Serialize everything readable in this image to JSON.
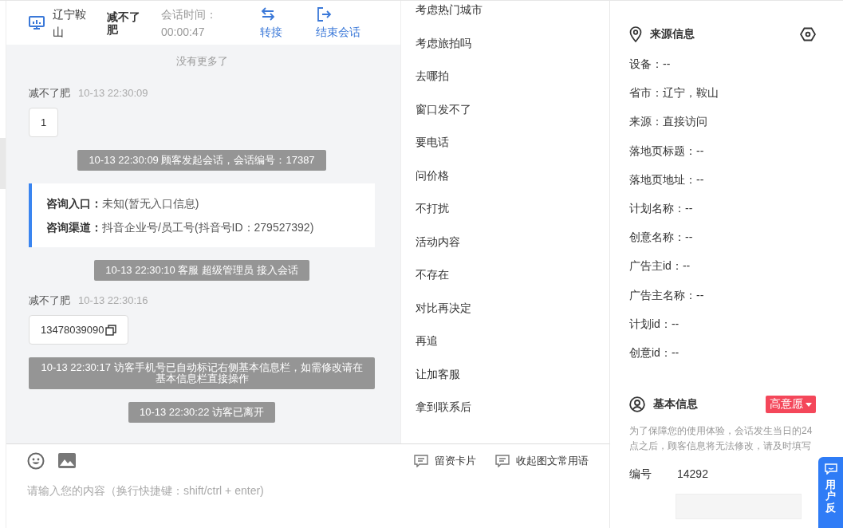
{
  "chat_header": {
    "location": "辽宁鞍山",
    "visitor": "减不了肥",
    "time_label": "会话时间：",
    "time": "00:00:47",
    "actions": [
      {
        "kind": "transfer",
        "label": "转接"
      },
      {
        "kind": "end",
        "label": "结束会话"
      }
    ]
  },
  "chat": {
    "notice": "没有更多了",
    "messages": [
      {
        "kind": "visitor",
        "sender": "减不了肥",
        "time": "10-13 22:30:09",
        "text": "1",
        "copy": false
      },
      {
        "kind": "system",
        "text": "10-13 22:30:09 顾客发起会话，会话编号：17387"
      },
      {
        "kind": "info",
        "lines": [
          "**咨询入口：**未知(暂无入口信息)",
          "**咨询渠道：**抖音企业号/员工号(抖音号ID：279527392)"
        ]
      },
      {
        "kind": "system",
        "text": "10-13 22:30:10 客服 超级管理员 接入会话"
      },
      {
        "kind": "visitor",
        "sender": "减不了肥",
        "time": "10-13 22:30:16",
        "text": "13478039090",
        "copy": true
      },
      {
        "kind": "system",
        "text": "10-13 22:30:17 访客手机号已自动标记右侧基本信息栏，如需修改请在基本信息栏直接操作"
      },
      {
        "kind": "system",
        "text": "10-13 22:30:22 访客已离开"
      }
    ]
  },
  "phrases": [
    "考虑热门城市",
    "考虑旅拍吗",
    "去哪拍",
    "窗口发不了",
    "要电话",
    "问价格",
    "不打扰",
    "活动内容",
    "不存在",
    "对比再决定",
    "再追",
    "让加客服",
    "拿到联系后"
  ],
  "composer": {
    "actions": [
      "留资卡片",
      "收起图文常用语"
    ],
    "placeholder": "请输入您的内容（换行快捷键：shift/ctrl + enter)"
  },
  "source_info": {
    "title": "来源信息",
    "fields": [
      "设备：--",
      "省市：辽宁，鞍山",
      "来源：直接访问",
      "落地页标题：--",
      "落地页地址：--",
      "计划名称：--",
      "创意名称：--",
      "广告主id：--",
      "广告主名称：--",
      "计划id：--",
      "创意id：--"
    ]
  },
  "basic_info": {
    "title": "基本信息",
    "intent": "高意愿",
    "note": "为了保障您的使用体验，会话发生当日的24点之后，顾客信息将无法修改，请及时填写",
    "fields": [
      {
        "label": "编号",
        "value": "14292"
      }
    ]
  },
  "feedback_tab": "用户反"
}
